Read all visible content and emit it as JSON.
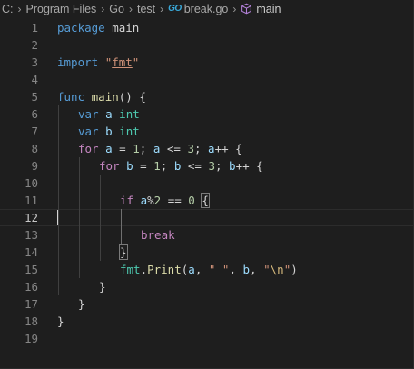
{
  "breadcrumb": {
    "items": [
      "C:",
      "Program Files",
      "Go",
      "test"
    ],
    "file_logo": "GO",
    "file_name": "break.go",
    "symbol": "main"
  },
  "editor": {
    "cursor_line": 12,
    "lines": [
      {
        "n": "1",
        "indent": 0,
        "tokens": [
          [
            "kw",
            "package"
          ],
          [
            "plain",
            " "
          ],
          [
            "plain",
            "main"
          ]
        ]
      },
      {
        "n": "2",
        "indent": 0,
        "tokens": []
      },
      {
        "n": "3",
        "indent": 0,
        "tokens": [
          [
            "kw",
            "import"
          ],
          [
            "plain",
            " "
          ],
          [
            "str",
            "\""
          ],
          [
            "str-u",
            "fmt"
          ],
          [
            "str",
            "\""
          ]
        ]
      },
      {
        "n": "4",
        "indent": 0,
        "tokens": []
      },
      {
        "n": "5",
        "indent": 0,
        "tokens": [
          [
            "kw",
            "func"
          ],
          [
            "plain",
            " "
          ],
          [
            "fn",
            "main"
          ],
          [
            "plain",
            "() {"
          ]
        ]
      },
      {
        "n": "6",
        "indent": 1,
        "tokens": [
          [
            "kw",
            "var"
          ],
          [
            "plain",
            " "
          ],
          [
            "var",
            "a"
          ],
          [
            "plain",
            " "
          ],
          [
            "ty",
            "int"
          ]
        ]
      },
      {
        "n": "7",
        "indent": 1,
        "tokens": [
          [
            "kw",
            "var"
          ],
          [
            "plain",
            " "
          ],
          [
            "var",
            "b"
          ],
          [
            "plain",
            " "
          ],
          [
            "ty",
            "int"
          ]
        ]
      },
      {
        "n": "8",
        "indent": 1,
        "tokens": [
          [
            "ctl",
            "for"
          ],
          [
            "plain",
            " "
          ],
          [
            "var",
            "a"
          ],
          [
            "plain",
            " = "
          ],
          [
            "num",
            "1"
          ],
          [
            "plain",
            "; "
          ],
          [
            "var",
            "a"
          ],
          [
            "plain",
            " <= "
          ],
          [
            "num",
            "3"
          ],
          [
            "plain",
            "; "
          ],
          [
            "var",
            "a"
          ],
          [
            "plain",
            "++ {"
          ]
        ]
      },
      {
        "n": "9",
        "indent": 2,
        "tokens": [
          [
            "ctl",
            "for"
          ],
          [
            "plain",
            " "
          ],
          [
            "var",
            "b"
          ],
          [
            "plain",
            " = "
          ],
          [
            "num",
            "1"
          ],
          [
            "plain",
            "; "
          ],
          [
            "var",
            "b"
          ],
          [
            "plain",
            " <= "
          ],
          [
            "num",
            "3"
          ],
          [
            "plain",
            "; "
          ],
          [
            "var",
            "b"
          ],
          [
            "plain",
            "++ {"
          ]
        ]
      },
      {
        "n": "10",
        "indent": 0,
        "tokens": []
      },
      {
        "n": "11",
        "indent": 3,
        "tokens": [
          [
            "ctl",
            "if"
          ],
          [
            "plain",
            " "
          ],
          [
            "var",
            "a"
          ],
          [
            "plain",
            "%"
          ],
          [
            "num",
            "2"
          ],
          [
            "plain",
            " == "
          ],
          [
            "num",
            "0"
          ],
          [
            "plain",
            " "
          ],
          [
            "brk",
            "{"
          ]
        ]
      },
      {
        "n": "12",
        "indent": 0,
        "tokens": []
      },
      {
        "n": "13",
        "indent": 4,
        "tokens": [
          [
            "ctl",
            "break"
          ]
        ]
      },
      {
        "n": "14",
        "indent": 3,
        "tokens": [
          [
            "brk",
            "}"
          ]
        ]
      },
      {
        "n": "15",
        "indent": 3,
        "tokens": [
          [
            "pkg",
            "fmt"
          ],
          [
            "plain",
            "."
          ],
          [
            "fn",
            "Print"
          ],
          [
            "plain",
            "("
          ],
          [
            "var",
            "a"
          ],
          [
            "plain",
            ", "
          ],
          [
            "str",
            "\" \""
          ],
          [
            "plain",
            ", "
          ],
          [
            "var",
            "b"
          ],
          [
            "plain",
            ", "
          ],
          [
            "str",
            "\""
          ],
          [
            "esc",
            "\\n"
          ],
          [
            "str",
            "\""
          ],
          [
            "plain",
            ")"
          ]
        ]
      },
      {
        "n": "16",
        "indent": 2,
        "tokens": [
          [
            "plain",
            "}"
          ]
        ]
      },
      {
        "n": "17",
        "indent": 1,
        "tokens": [
          [
            "plain",
            "}"
          ]
        ]
      },
      {
        "n": "18",
        "indent": 0,
        "tokens": [
          [
            "plain",
            "}"
          ]
        ]
      },
      {
        "n": "19",
        "indent": 0,
        "tokens": []
      }
    ]
  }
}
